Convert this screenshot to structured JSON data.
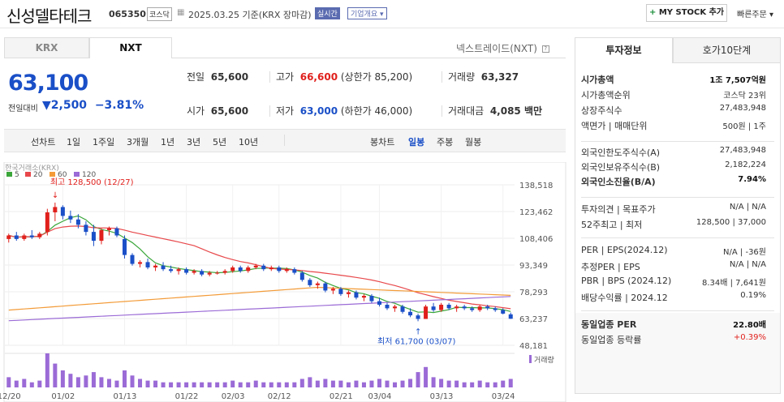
{
  "header": {
    "company": "신성델타테크",
    "code": "065350",
    "market": "코스닥",
    "date": "2025.03.25 기준(KRX 장마감)",
    "realtime": "실시간",
    "company_info": "기업개요 ▾",
    "mystock": "MY STOCK 추가",
    "quick_order": "빠른주문 ▾"
  },
  "tabs": {
    "krx": "KRX",
    "nxt": "NXT",
    "nxt_rate": "넥스트레이드(NXT)"
  },
  "quote": {
    "price": "63,100",
    "change_label": "전일대비",
    "change": "▼2,500",
    "change_pct": "−3.81%",
    "prev_label": "전일",
    "prev": "65,600",
    "high_label": "고가",
    "high": "66,600",
    "high_limit": "(상한가 85,200)",
    "volume_label": "거래량",
    "volume": "63,327",
    "open_label": "시가",
    "open": "65,600",
    "low_label": "저가",
    "low": "63,000",
    "low_limit": "(하한가 46,000)",
    "amount_label": "거래대금",
    "amount": "4,085 백만"
  },
  "periods": {
    "line_chart": "선차트",
    "items": [
      "1일",
      "1주일",
      "3개월",
      "1년",
      "3년",
      "5년",
      "10년"
    ],
    "candle_chart": "봉차트",
    "candle_items": [
      "일봉",
      "주봉",
      "월봉"
    ]
  },
  "chart_data": {
    "type": "candlestick",
    "source": "한국거래소(KRX)",
    "ma_legend": [
      {
        "label": "5",
        "color": "#3aa63a"
      },
      {
        "label": "20",
        "color": "#e8484b"
      },
      {
        "label": "60",
        "color": "#f39b38"
      },
      {
        "label": "120",
        "color": "#9b6bd6"
      }
    ],
    "max_label": "최고 128,500 (12/27)",
    "min_label": "최저 61,700 (03/07)",
    "y_ticks": [
      "138,518",
      "123,462",
      "108,406",
      "93,349",
      "78,293",
      "63,237",
      "48,181"
    ],
    "y_tick_values": [
      138518,
      123462,
      108406,
      93349,
      78293,
      63237,
      48181
    ],
    "x_ticks": [
      "12/20",
      "01/02",
      "01/13",
      "01/22",
      "02/03",
      "02/12",
      "02/21",
      "03/04",
      "03/13",
      "03/24"
    ],
    "volume_label": "거래량",
    "candles": [
      [
        108000,
        111000,
        106000,
        110000
      ],
      [
        110000,
        112000,
        107000,
        108000
      ],
      [
        108000,
        111000,
        107000,
        110000
      ],
      [
        110000,
        113000,
        108000,
        109000
      ],
      [
        109000,
        112000,
        108000,
        111000
      ],
      [
        112000,
        125000,
        110000,
        123000
      ],
      [
        123000,
        128500,
        118000,
        126000
      ],
      [
        126000,
        127000,
        119000,
        121000
      ],
      [
        121000,
        124000,
        117000,
        119000
      ],
      [
        119000,
        122000,
        114000,
        116000
      ],
      [
        116000,
        118000,
        110000,
        112000
      ],
      [
        112000,
        116000,
        104000,
        107000
      ],
      [
        107000,
        114000,
        105000,
        113000
      ],
      [
        113000,
        115000,
        110000,
        114000
      ],
      [
        114000,
        115000,
        109000,
        110000
      ],
      [
        108000,
        110000,
        97000,
        99000
      ],
      [
        99000,
        100000,
        93000,
        94000
      ],
      [
        94000,
        96000,
        92000,
        95000
      ],
      [
        95000,
        97000,
        91000,
        92000
      ],
      [
        92000,
        94000,
        90000,
        93000
      ],
      [
        93000,
        95000,
        90000,
        91000
      ],
      [
        91000,
        93000,
        89000,
        90000
      ],
      [
        90000,
        92000,
        88000,
        91000
      ],
      [
        91000,
        92000,
        88000,
        89000
      ],
      [
        89000,
        91000,
        88000,
        90000
      ],
      [
        90000,
        91000,
        87000,
        88000
      ],
      [
        88000,
        90000,
        87000,
        89000
      ],
      [
        89000,
        90000,
        88000,
        89000
      ],
      [
        89000,
        91000,
        88000,
        90000
      ],
      [
        90000,
        93000,
        89000,
        92000
      ],
      [
        92000,
        93000,
        89000,
        90000
      ],
      [
        90000,
        93000,
        89000,
        92000
      ],
      [
        92000,
        94000,
        91000,
        93000
      ],
      [
        93000,
        94000,
        90000,
        91000
      ],
      [
        91000,
        93000,
        90000,
        92000
      ],
      [
        92000,
        93000,
        89000,
        90000
      ],
      [
        90000,
        92000,
        89000,
        91000
      ],
      [
        91000,
        92000,
        88000,
        89000
      ],
      [
        89000,
        90000,
        84000,
        85000
      ],
      [
        85000,
        86000,
        81000,
        82000
      ],
      [
        82000,
        84000,
        80000,
        83000
      ],
      [
        83000,
        84000,
        78000,
        79000
      ],
      [
        79000,
        81000,
        77000,
        80000
      ],
      [
        80000,
        81000,
        76000,
        77000
      ],
      [
        77000,
        79000,
        75000,
        78000
      ],
      [
        78000,
        79000,
        74000,
        75000
      ],
      [
        75000,
        77000,
        73000,
        76000
      ],
      [
        76000,
        77000,
        72000,
        73000
      ],
      [
        73000,
        75000,
        70000,
        71000
      ],
      [
        71000,
        72000,
        68000,
        69000
      ],
      [
        69000,
        71000,
        67000,
        70000
      ],
      [
        70000,
        71000,
        66000,
        67000
      ],
      [
        67000,
        69000,
        64000,
        65000
      ],
      [
        65000,
        66000,
        61700,
        63000
      ],
      [
        63000,
        71000,
        63000,
        70000
      ],
      [
        70000,
        72000,
        67000,
        68000
      ],
      [
        68000,
        72000,
        67000,
        71000
      ],
      [
        71000,
        72000,
        68000,
        69000
      ],
      [
        69000,
        71000,
        67000,
        70000
      ],
      [
        70000,
        71000,
        68000,
        69000
      ],
      [
        69000,
        70000,
        67000,
        68000
      ],
      [
        68000,
        71000,
        67000,
        70000
      ],
      [
        70000,
        71000,
        68000,
        69000
      ],
      [
        69000,
        70000,
        67000,
        68000
      ],
      [
        68000,
        69000,
        65600,
        66000
      ],
      [
        65600,
        66600,
        63000,
        63100
      ]
    ],
    "volumes": [
      6,
      4,
      5,
      3,
      4,
      20,
      14,
      10,
      8,
      6,
      7,
      9,
      6,
      5,
      4,
      10,
      7,
      5,
      4,
      4,
      3,
      3,
      3,
      3,
      3,
      3,
      3,
      3,
      3,
      4,
      3,
      3,
      4,
      3,
      3,
      3,
      3,
      3,
      5,
      6,
      4,
      5,
      4,
      4,
      3,
      4,
      3,
      4,
      5,
      4,
      3,
      4,
      5,
      9,
      12,
      6,
      5,
      4,
      4,
      3,
      3,
      4,
      3,
      3,
      4,
      5
    ]
  },
  "invest": {
    "tab1": "투자정보",
    "tab2": "호가10단계",
    "rows1": [
      {
        "k": "시가총액",
        "v": "1조 7,507억원"
      },
      {
        "k": "시가총액순위",
        "v": "코스닥 23위"
      },
      {
        "k": "상장주식수",
        "v": "27,483,948"
      },
      {
        "k": "액면가 | 매매단위",
        "v": "500원 | 1주"
      }
    ],
    "rows2": [
      {
        "k": "외국인한도주식수(A)",
        "v": "27,483,948"
      },
      {
        "k": "외국인보유주식수(B)",
        "v": "2,182,224"
      },
      {
        "k": "외국인소진율(B/A)",
        "v": "7.94%"
      }
    ],
    "rows3": [
      {
        "k": "투자의견 | 목표주가",
        "v": "N/A | N/A"
      },
      {
        "k": "52주최고 | 최저",
        "v": "128,500 | 37,000"
      }
    ],
    "rows4": [
      {
        "k": "PER | EPS(2024.12)",
        "v": "N/A | -36원"
      },
      {
        "k": "추정PER | EPS",
        "v": "N/A | N/A"
      },
      {
        "k": "PBR | BPS (2024.12)",
        "v": "8.34배 | 7,641원"
      },
      {
        "k": "배당수익률 | 2024.12",
        "v": "0.19%"
      }
    ],
    "rows5": [
      {
        "k": "동일업종 PER",
        "v": "22.80배"
      },
      {
        "k": "동일업종 등락률",
        "v": "+0.39%"
      }
    ]
  }
}
